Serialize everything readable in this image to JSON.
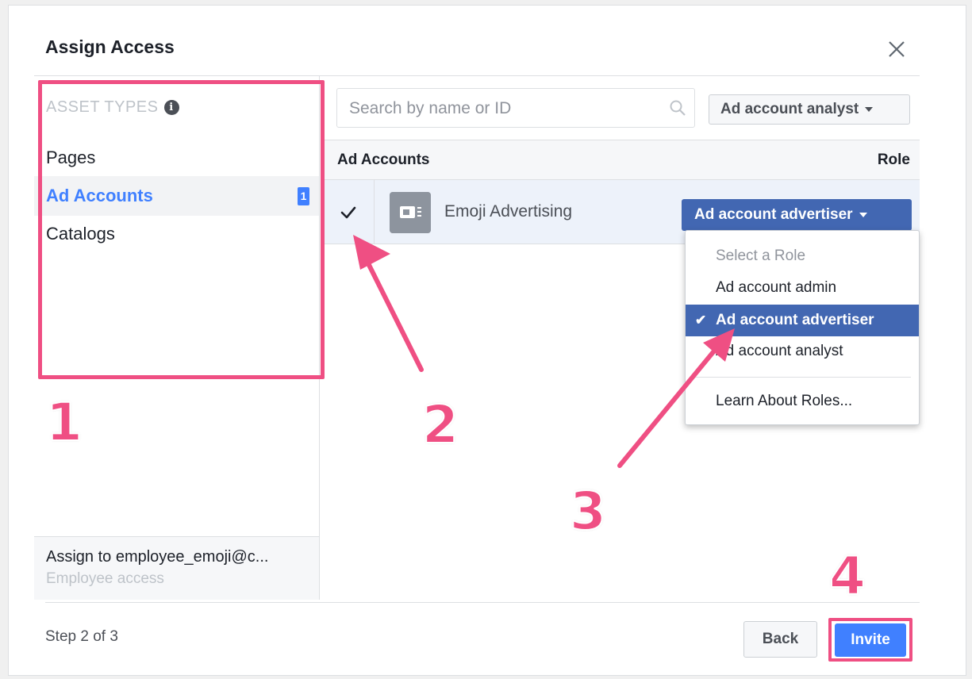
{
  "dialog": {
    "title": "Assign Access"
  },
  "sidebar": {
    "header": "ASSET TYPES",
    "items": [
      {
        "label": "Pages"
      },
      {
        "label": "Ad Accounts",
        "badge": "1",
        "active": true
      },
      {
        "label": "Catalogs"
      }
    ],
    "assign_to": "Assign to employee_emoji@c...",
    "access_type": "Employee access"
  },
  "search": {
    "placeholder": "Search by name or ID"
  },
  "filter": {
    "selected": "Ad account analyst"
  },
  "table": {
    "col_name": "Ad Accounts",
    "col_role": "Role",
    "rows": [
      {
        "name": "Emoji Advertising",
        "checked": true,
        "role": "Ad account advertiser"
      }
    ]
  },
  "role_menu": {
    "header": "Select a Role",
    "options": [
      {
        "label": "Ad account admin"
      },
      {
        "label": "Ad account advertiser",
        "selected": true
      },
      {
        "label": "Ad account analyst"
      }
    ],
    "learn_more": "Learn About Roles..."
  },
  "footer": {
    "step": "Step 2 of 3",
    "back_label": "Back",
    "invite_label": "Invite"
  },
  "annotations": {
    "step1": "1",
    "step2": "2",
    "step3": "3",
    "step4": "4",
    "color": "#ef4f83"
  },
  "colors": {
    "accent": "#4080ff",
    "primary_button": "#4267b2",
    "row_selected": "#edf2fa"
  }
}
